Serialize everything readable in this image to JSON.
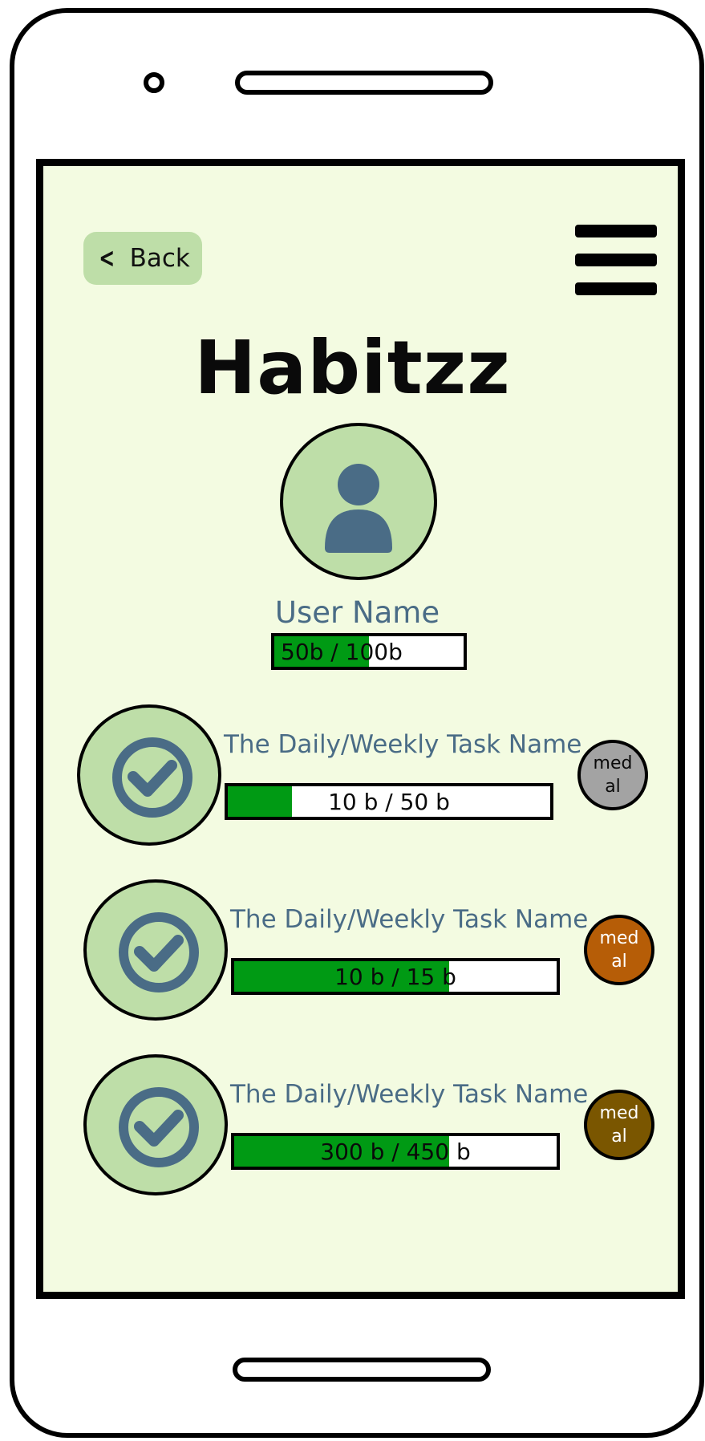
{
  "app": {
    "title": "Habitzz"
  },
  "nav": {
    "back_label": "Back",
    "back_icon": "chevron-left-icon",
    "menu_icon": "hamburger-menu-icon"
  },
  "profile": {
    "avatar_icon": "user-icon",
    "username": "User Name",
    "points_text": "50b / 100b",
    "points_progress": 0.5
  },
  "tasks": [
    {
      "name": "The Daily/Weekly Task Name",
      "progress_text": "10 b / 50 b",
      "progress": 0.2,
      "medal_line1": "med",
      "medal_line2": "al",
      "medal_color": "#a3a3a3",
      "medal_text_color": "#0a0a0a",
      "icon": "check-circle-icon"
    },
    {
      "name": "The Daily/Weekly Task Name",
      "progress_text": "10 b / 15 b",
      "progress": 0.667,
      "medal_line1": "med",
      "medal_line2": "al",
      "medal_color": "#b65d07",
      "medal_text_color": "#ffffff",
      "icon": "check-circle-icon"
    },
    {
      "name": "The Daily/Weekly Task Name",
      "progress_text": "300 b / 450 b",
      "progress": 0.667,
      "medal_line1": "med",
      "medal_line2": "al",
      "medal_color": "#7a5600",
      "medal_text_color": "#ffffff",
      "icon": "check-circle-icon"
    }
  ],
  "colors": {
    "screen_bg": "#f3fbe1",
    "accent_green": "#bedea8",
    "progress_fill": "#009a14",
    "icon_blue": "#4a6c86"
  }
}
